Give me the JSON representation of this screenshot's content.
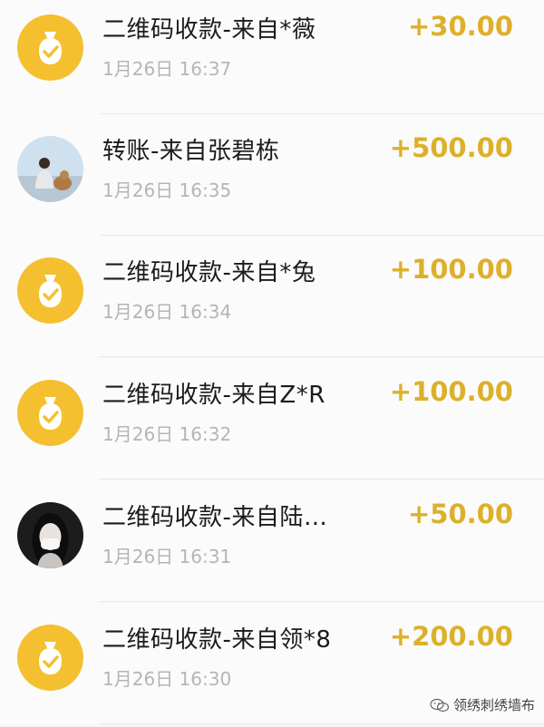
{
  "transactions": [
    {
      "title": "二维码收款-来自*薇",
      "time": "1月26日 16:37",
      "amount": "+30.00",
      "avatar": "coin-bag-icon"
    },
    {
      "title": "转账-来自张碧栋",
      "time": "1月26日 16:35",
      "amount": "+500.00",
      "avatar": "user-photo"
    },
    {
      "title": "二维码收款-来自*兔",
      "time": "1月26日 16:34",
      "amount": "+100.00",
      "avatar": "coin-bag-icon"
    },
    {
      "title": "二维码收款-来自Z*R",
      "time": "1月26日 16:32",
      "amount": "+100.00",
      "avatar": "coin-bag-icon"
    },
    {
      "title": "二维码收款-来自陆…",
      "time": "1月26日 16:31",
      "amount": "+50.00",
      "avatar": "user-photo"
    },
    {
      "title": "二维码收款-来自领*8",
      "time": "1月26日 16:30",
      "amount": "+200.00",
      "avatar": "coin-bag-icon"
    }
  ],
  "watermark": {
    "text": "领绣刺绣墙布",
    "icon": "wechat-icon"
  },
  "colors": {
    "accent": "#f4c02f",
    "amount": "#ddb02b",
    "secondary_text": "#b5b5b5"
  }
}
